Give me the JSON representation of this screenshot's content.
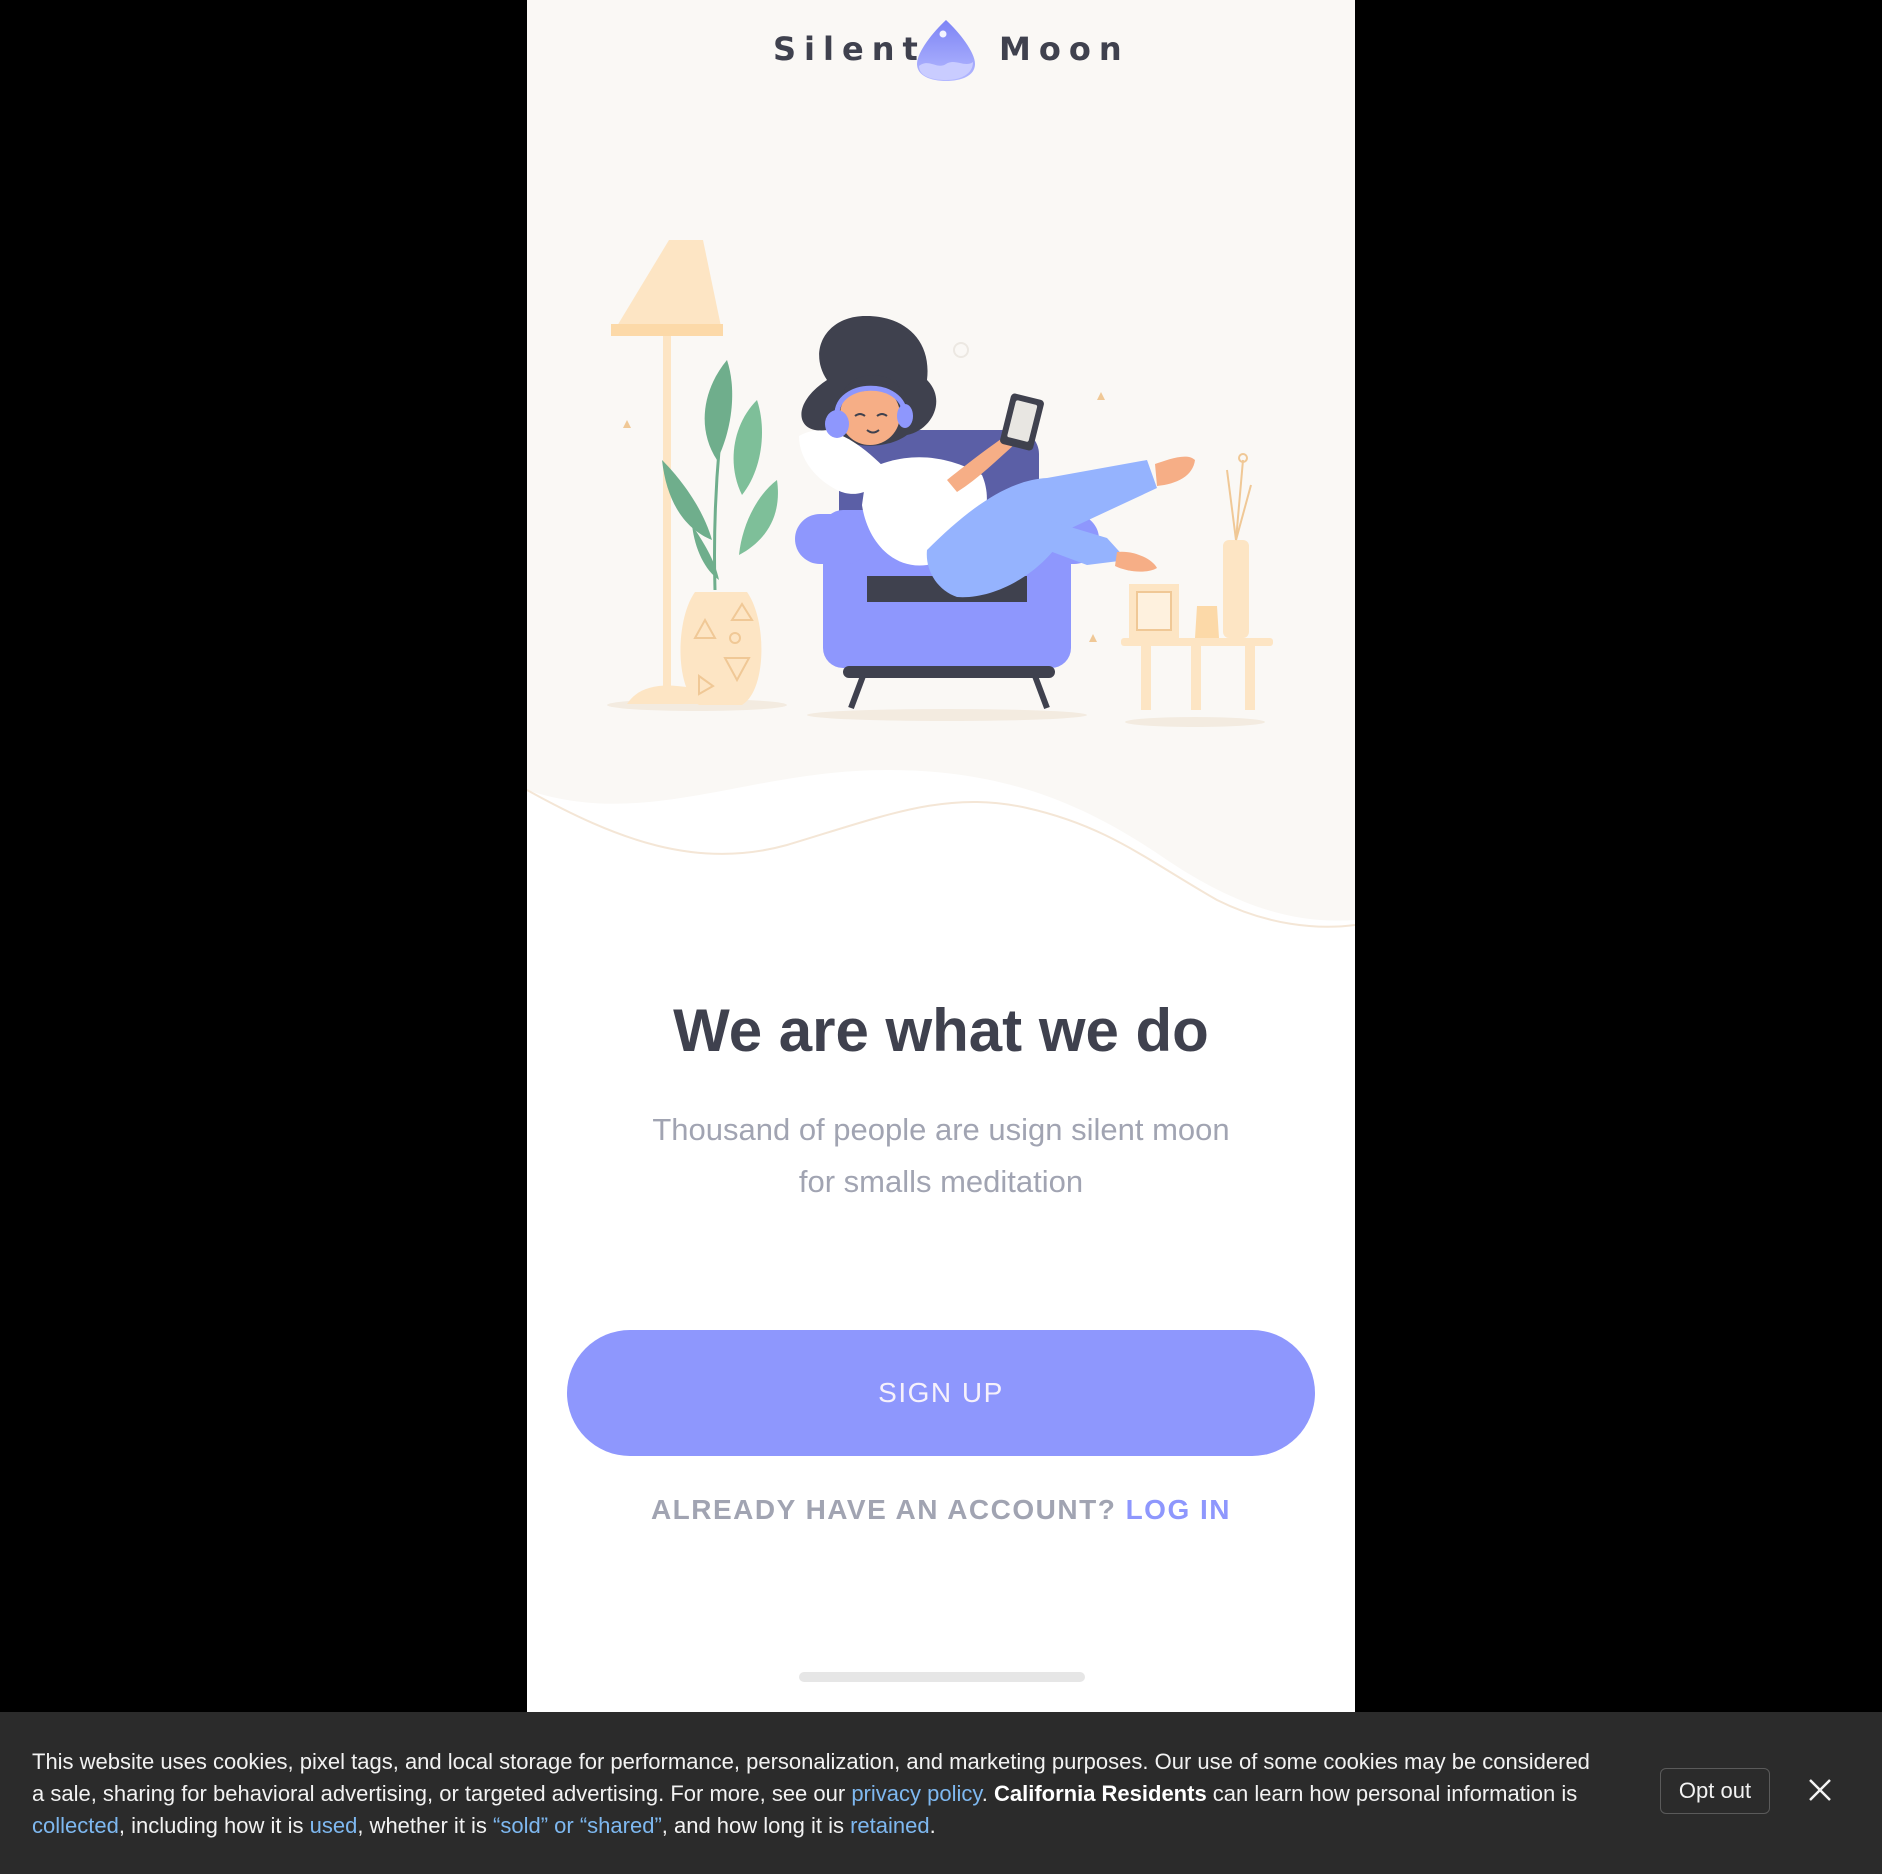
{
  "app": {
    "brand_left": "Silent",
    "brand_right": "Moon"
  },
  "welcome": {
    "headline": "We are what we do",
    "subtext": "Thousand of people are usign silent moon for smalls meditation",
    "signup_label": "SIGN UP",
    "login_prompt": "ALREADY HAVE AN ACCOUNT?",
    "login_label": "LOG IN"
  },
  "cookie_banner": {
    "text_1": "This website uses cookies, pixel tags, and local storage for performance, personalization, and marketing purposes. Our use of some cookies may be considered a sale, sharing for behavioral advertising, or targeted advertising. For more, see our ",
    "privacy_link": "privacy policy",
    "text_2": ". ",
    "california_label": "California Residents",
    "text_3": " can learn how personal information is ",
    "collected_link": "collected",
    "text_4": ", including how it is ",
    "used_link": "used",
    "text_5": ", whether it is ",
    "sold_link": "“sold” or “shared”",
    "text_6": ", and how long it is ",
    "retained_link": "retained",
    "text_7": ".",
    "optout_label": "Opt out"
  },
  "colors": {
    "accent": "#8e97fd",
    "heading": "#3f414e",
    "muted": "#a1a4b2",
    "hero_bg": "#faf8f5",
    "banner_bg": "#2b2b2b",
    "link": "#7eb8f0"
  },
  "icons": {
    "logo": "moon-drop-logo",
    "close": "close-icon"
  }
}
